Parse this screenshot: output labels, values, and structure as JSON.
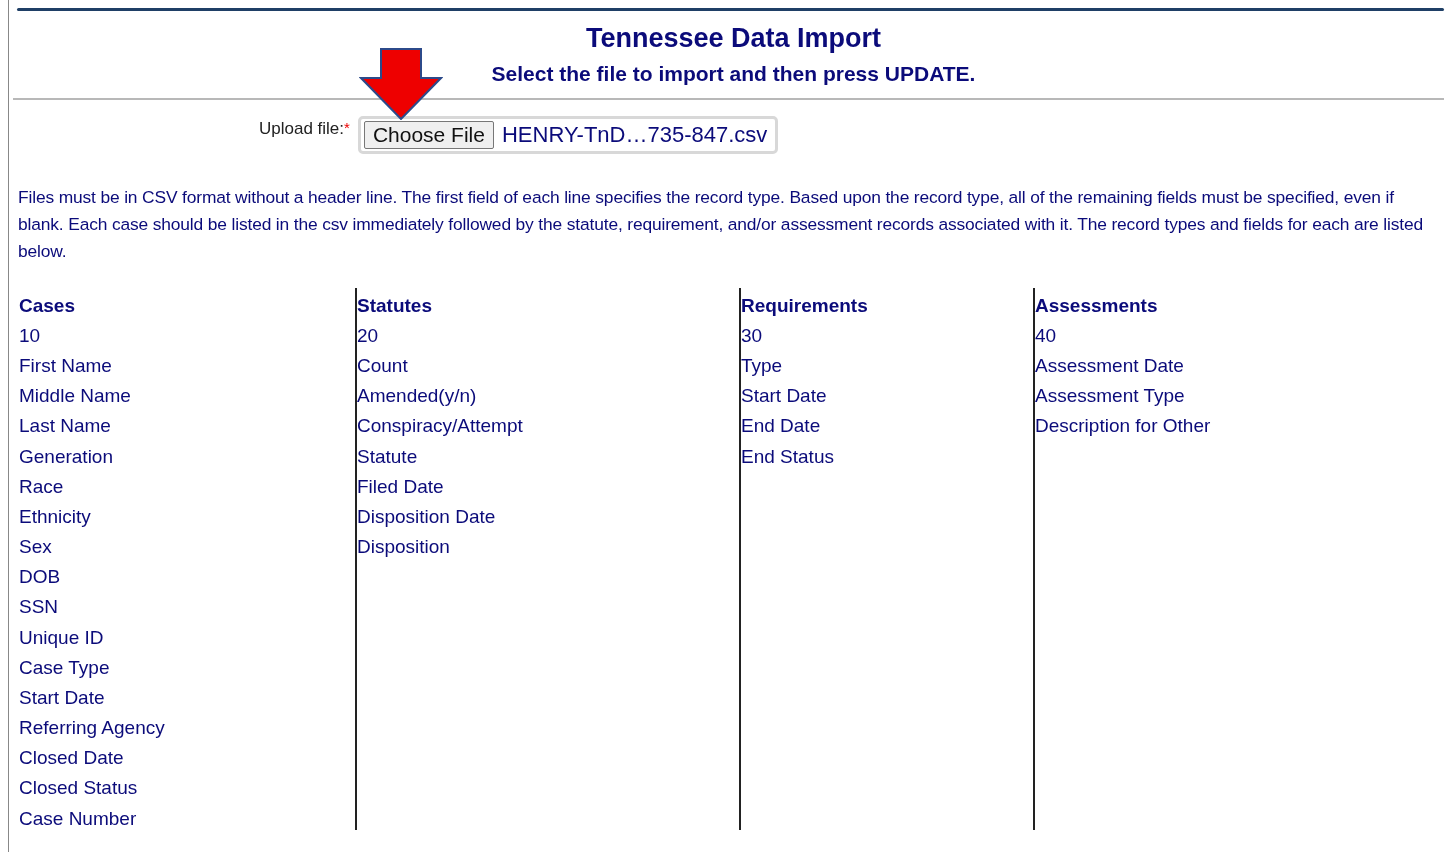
{
  "header": {
    "title": "Tennessee Data Import",
    "subtitle": "Select the file to import and then press UPDATE."
  },
  "upload": {
    "label": "Upload file:",
    "required_mark": "*",
    "button": "Choose File",
    "file_name": "HENRY-TnD…735-847.csv"
  },
  "instructions": "Files must be in CSV format without a header line. The first field of each line specifies the record type. Based upon the record type, all of the remaining fields must be specified, even if blank. Each case should be listed in the csv immediately followed by the statute, requirement, and/or assessment records associated with it. The record types and fields for each are listed below.",
  "record_types": [
    {
      "heading": "Cases",
      "fields": [
        "10",
        "First Name",
        "Middle Name",
        "Last Name",
        "Generation",
        "Race",
        "Ethnicity",
        "Sex",
        "DOB",
        "SSN",
        "Unique ID",
        "Case Type",
        "Start Date",
        "Referring Agency",
        "Closed Date",
        "Closed Status",
        "Case Number"
      ]
    },
    {
      "heading": "Statutes",
      "fields": [
        "20",
        "Count",
        "Amended(y/n)",
        "Conspiracy/Attempt",
        "Statute",
        "Filed Date",
        "Disposition Date",
        "Disposition"
      ]
    },
    {
      "heading": "Requirements",
      "fields": [
        "30",
        "Type",
        "Start Date",
        "End Date",
        "End Status"
      ]
    },
    {
      "heading": "Assessments",
      "fields": [
        "40",
        "Assessment Date",
        "Assessment Type",
        "Description for Other"
      ]
    }
  ]
}
